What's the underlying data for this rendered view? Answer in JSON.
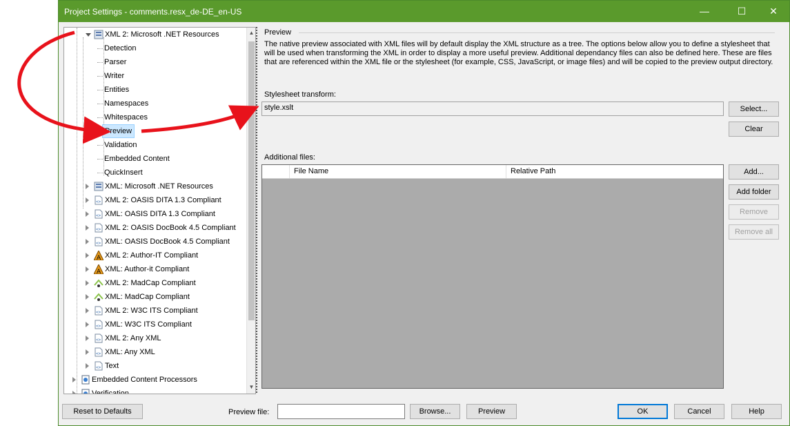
{
  "window": {
    "title": "Project Settings - comments.resx_de-DE_en-US",
    "accent": "#5a9a2c"
  },
  "titlebar_buttons": {
    "minimize": "—",
    "maximize": "☐",
    "close": "✕"
  },
  "tree": {
    "items": [
      {
        "label": "XML 2: Microsoft .NET Resources",
        "icon": "xml-resource-icon",
        "expanded": true
      },
      {
        "label": "Detection"
      },
      {
        "label": "Parser"
      },
      {
        "label": "Writer"
      },
      {
        "label": "Entities"
      },
      {
        "label": "Namespaces"
      },
      {
        "label": "Whitespaces"
      },
      {
        "label": "Preview",
        "selected": true
      },
      {
        "label": "Validation"
      },
      {
        "label": "Embedded Content"
      },
      {
        "label": "QuickInsert"
      },
      {
        "label": "XML: Microsoft .NET Resources",
        "icon": "xml-resource-icon"
      },
      {
        "label": "XML 2: OASIS DITA 1.3 Compliant",
        "icon": "xml-file-icon"
      },
      {
        "label": "XML: OASIS DITA 1.3 Compliant",
        "icon": "xml-file-icon"
      },
      {
        "label": "XML 2: OASIS DocBook 4.5 Compliant",
        "icon": "xml-file-icon"
      },
      {
        "label": "XML: OASIS DocBook 4.5 Compliant",
        "icon": "xml-file-icon"
      },
      {
        "label": "XML 2: Author-IT Compliant",
        "icon": "author-it-icon"
      },
      {
        "label": "XML: Author-it Compliant",
        "icon": "author-it-icon"
      },
      {
        "label": "XML 2: MadCap Compliant",
        "icon": "madcap-icon"
      },
      {
        "label": "XML: MadCap Compliant",
        "icon": "madcap-icon"
      },
      {
        "label": "XML 2: W3C ITS Compliant",
        "icon": "xml-file-icon"
      },
      {
        "label": "XML: W3C ITS Compliant",
        "icon": "xml-file-icon"
      },
      {
        "label": "XML 2: Any XML",
        "icon": "xml-file-icon"
      },
      {
        "label": "XML: Any XML",
        "icon": "xml-file-icon"
      },
      {
        "label": "Text",
        "icon": "text-file-icon"
      },
      {
        "label": "Embedded Content Processors",
        "icon": "gear-doc-icon"
      },
      {
        "label": "Verification",
        "icon": "verification-icon"
      }
    ]
  },
  "preview_panel": {
    "title": "Preview",
    "description": "The native preview associated with XML files will by default display the XML structure as a tree.  The options below allow you to define a stylesheet that will be used when transforming the XML in order to display a more useful preview.  Additional dependancy files can also be defined here.  These are files that are referenced within the XML file or the stylesheet (for example, CSS, JavaScript, or image files) and will be copied to the preview output directory.",
    "stylesheet_label": "Stylesheet transform:",
    "stylesheet_value": "style.xslt",
    "select_button": "Select...",
    "clear_button": "Clear",
    "additional_files_label": "Additional files:",
    "columns": [
      "File Name",
      "Relative Path"
    ],
    "add_button": "Add...",
    "add_folder_button": "Add folder",
    "remove_button": "Remove",
    "remove_all_button": "Remove all"
  },
  "footer": {
    "reset_button": "Reset to Defaults",
    "preview_file_label": "Preview file:",
    "preview_file_value": "",
    "browse_button": "Browse...",
    "preview_button": "Preview",
    "ok_button": "OK",
    "cancel_button": "Cancel",
    "help_button": "Help"
  },
  "annotation_color": "#e8121b"
}
